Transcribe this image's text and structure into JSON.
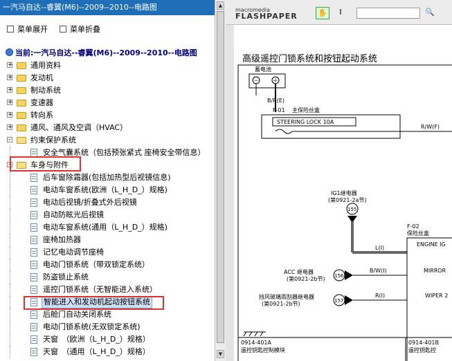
{
  "window": {
    "title": "一汽马自达--睿翼(M6)--2009--2010--电路图"
  },
  "menu": {
    "expand": "菜单展开",
    "collapse": "菜单折叠"
  },
  "current": "当前:一汽马自达--睿翼(M6)--2009--2010--电路图",
  "tree": {
    "folders": [
      {
        "label": "通用资料",
        "pm": "+"
      },
      {
        "label": "发动机",
        "pm": "+"
      },
      {
        "label": "制动系统",
        "pm": "+"
      },
      {
        "label": "变速器",
        "pm": "+"
      },
      {
        "label": "转向系",
        "pm": "+"
      },
      {
        "label": "通风、通风及空调（HVAC）",
        "pm": "+"
      },
      {
        "label": "约束保护系统",
        "pm": "-"
      }
    ],
    "restraint_children": [
      {
        "label": "安全气囊系统（包括预张紧式 座椅安全带信息）"
      }
    ],
    "body_folder": {
      "label": "车身与附件",
      "pm": "-"
    },
    "body_children": [
      {
        "label": "后车窗除霜器(包括加热型后视镜信息)"
      },
      {
        "label": "电动车窗系统(欧洲（L_H_D_）规格)"
      },
      {
        "label": "电动后视镜/折叠式外后视镜"
      },
      {
        "label": "自动防眩光后视镜"
      },
      {
        "label": "电动车窗系统(通用（L_H_D_）规格)"
      },
      {
        "label": "座椅加热器"
      },
      {
        "label": "记忆电动调节座椅"
      },
      {
        "label": "电动门锁系统（带双锁定系统）"
      },
      {
        "label": "防盗锁止系统"
      },
      {
        "label": "遥控门锁系统（无智能进入系统）"
      },
      {
        "label": "智能进入和发动机起动按钮系统",
        "selected": true
      },
      {
        "label": "后舱门自动关闭系统"
      },
      {
        "label": "电动门锁系统(无双锁定系统)"
      },
      {
        "label": "天窗　（欧洲（L_H_D_）规格）"
      },
      {
        "label": "天窗　（通用（L_H_D_）规格）"
      }
    ]
  },
  "viewer": {
    "logo_top": "macromedia",
    "logo_bottom": "FLASHPAPER",
    "search_icon": "magnifier-icon",
    "hand_icon": "hand-icon",
    "cursor_icon": "text-cursor-icon"
  },
  "diagram": {
    "title": "高级遥控门锁系统和按钮起动系统",
    "battery": "蓄电池",
    "minus": "－",
    "plus": "＋",
    "wire1": "B/R(E)",
    "fuse_main_code": "F-01",
    "fuse_main_name": "主保险丝盒",
    "steering_lock": "STEERING LOCK 10A",
    "wire2": "R/W(F)",
    "ig1_relay": "IG1继电器",
    "ig1_ref": "(第0921-2a节)",
    "node155": "155",
    "wire_l": "L(I)",
    "fuse2_code": "F-02",
    "fuse2_name": "保险丝盒",
    "engine_ig": "ENGINE IG",
    "acc_relay": "ACC 继电器",
    "acc_ref": "(第0921-2b节)",
    "node156": "156",
    "wire_bw": "B/W(I)",
    "mirror": "MIRROR",
    "wiper_relay": "挡风玻璃雨刮器继电器",
    "wiper_ref": "(第0921-2b节)",
    "node157": "157",
    "wire_r": "R(I)",
    "wiper": "WIPER 2",
    "footer_left_code": "0914-401A",
    "footer_left_name": "遥控钥匙控制模块",
    "footer_right_code": "0914-401B",
    "footer_right_name": "遥控钥匙控"
  }
}
